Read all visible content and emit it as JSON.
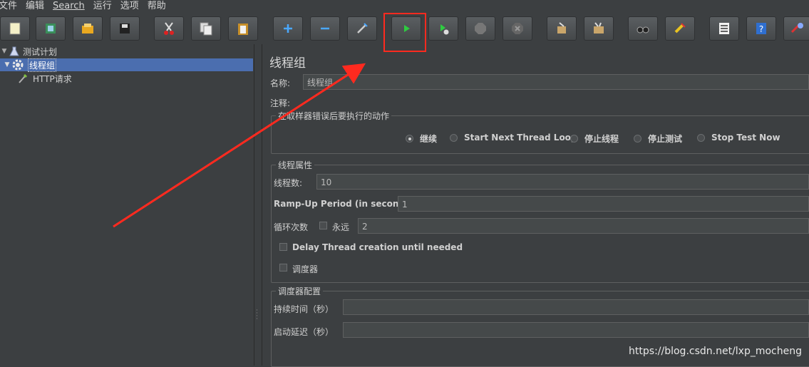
{
  "menu": [
    "文件",
    "编辑",
    "Search",
    "运行",
    "选项",
    "帮助"
  ],
  "toolbar": {
    "buttons": [
      {
        "name": "new-button",
        "icon": "new-file-icon"
      },
      {
        "name": "templates-button",
        "icon": "templates-icon"
      },
      {
        "name": "open-button",
        "icon": "open-folder-icon"
      },
      {
        "name": "save-button",
        "icon": "save-icon"
      },
      {
        "name": "cut-button",
        "icon": "scissors-icon"
      },
      {
        "name": "copy-button",
        "icon": "copy-icon"
      },
      {
        "name": "paste-button",
        "icon": "paste-icon"
      },
      {
        "name": "expand-button",
        "icon": "plus-icon"
      },
      {
        "name": "collapse-button",
        "icon": "minus-icon"
      },
      {
        "name": "toggle-button",
        "icon": "wand-icon"
      },
      {
        "name": "start-button",
        "icon": "play-icon"
      },
      {
        "name": "start-no-pauses-button",
        "icon": "play-no-timer-icon"
      },
      {
        "name": "stop-button",
        "icon": "stop-icon"
      },
      {
        "name": "shutdown-button",
        "icon": "shutdown-icon"
      },
      {
        "name": "clear-button",
        "icon": "broom-icon"
      },
      {
        "name": "clear-all-button",
        "icon": "broom-all-icon"
      },
      {
        "name": "search-button",
        "icon": "binoculars-icon"
      },
      {
        "name": "reset-search-button",
        "icon": "reset-search-icon"
      },
      {
        "name": "function-helper-button",
        "icon": "list-icon"
      },
      {
        "name": "help-button",
        "icon": "help-icon"
      },
      {
        "name": "remote-button",
        "icon": "remote-icon"
      }
    ]
  },
  "tree": {
    "items": [
      {
        "label": "测试计划",
        "icon": "flask-icon"
      },
      {
        "label": "线程组",
        "icon": "gear-icon"
      },
      {
        "label": "HTTP请求",
        "icon": "pipette-icon"
      }
    ]
  },
  "panel": {
    "title": "线程组",
    "name_label": "名称:",
    "name_value": "线程组",
    "comment_label": "注释:",
    "error_group_title": "在取样器错误后要执行的动作",
    "error_actions": [
      {
        "label": "继续",
        "checked": true
      },
      {
        "label": "Start Next Thread Loop",
        "checked": false
      },
      {
        "label": "停止线程",
        "checked": false
      },
      {
        "label": "停止测试",
        "checked": false
      },
      {
        "label": "Stop Test Now",
        "checked": false
      }
    ],
    "thread_props_title": "线程属性",
    "threads_label": "线程数:",
    "threads_value": "10",
    "rampup_label": "Ramp-Up Period (in seconds):",
    "rampup_value": "1",
    "loop_label": "循环次数",
    "forever_label": "永远",
    "loop_value": "2",
    "delay_label": "Delay Thread creation until needed",
    "scheduler_label": "调度器",
    "scheduler_config_title": "调度器配置",
    "duration_label": "持续时间（秒）",
    "startup_delay_label": "启动延迟（秒）"
  },
  "watermark": "https://blog.csdn.net/lxp_mocheng",
  "colors": {
    "background": "#3c3f41",
    "selection": "#4b6eaf",
    "annotation": "#ff2a1f"
  }
}
